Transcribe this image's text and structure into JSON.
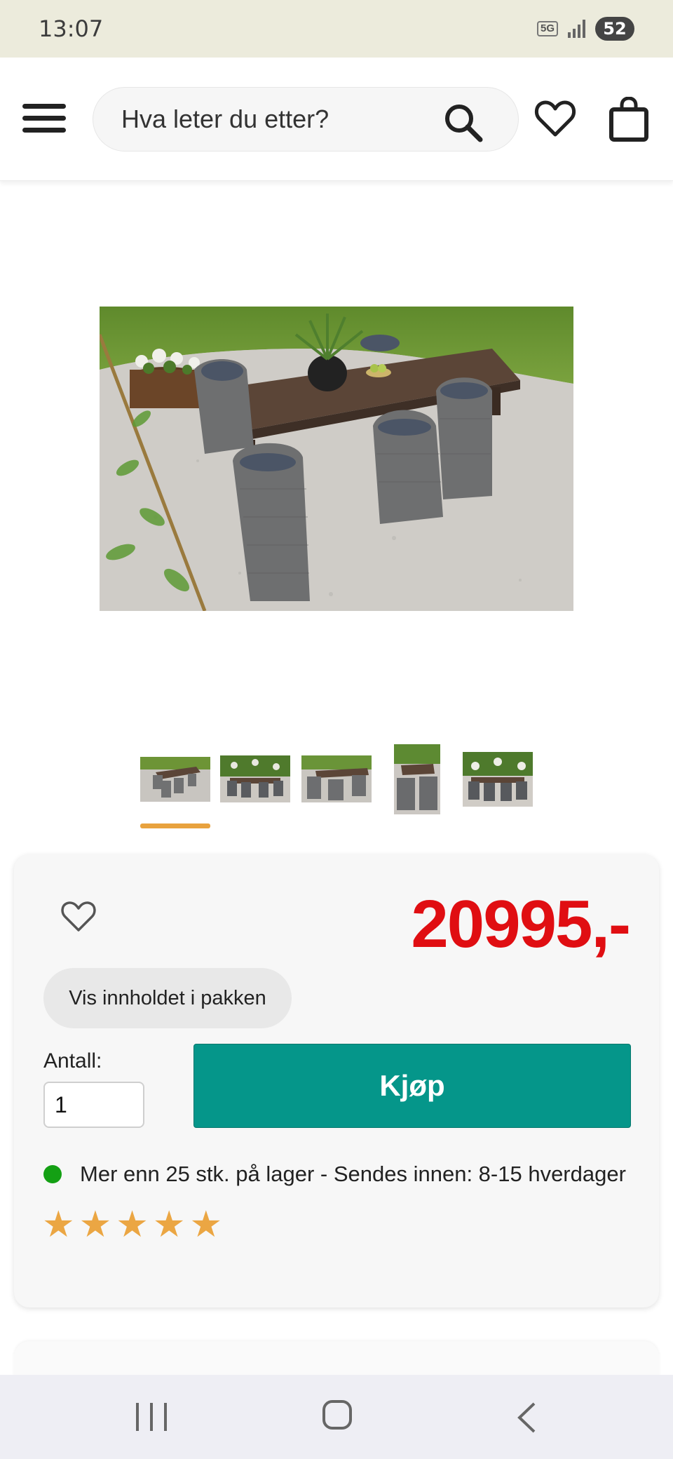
{
  "status_bar": {
    "time": "13:07",
    "network": "5G",
    "battery": "52"
  },
  "header": {
    "search_placeholder": "Hva leter du etter?",
    "icons": [
      "menu-icon",
      "search-icon",
      "heart-icon",
      "shopping-bag-icon"
    ]
  },
  "gallery": {
    "thumbnail_count": 5,
    "selected_index": 0,
    "accent_color": "#e8a23e"
  },
  "product": {
    "price": "20995,-",
    "package_button": "Vis innholdet i pakken",
    "quantity_label": "Antall:",
    "quantity_value": "1",
    "buy_button": "Kjøp",
    "stock_text": "Mer enn 25 stk. på lager - Sendes innen: 8-15 hverdager",
    "rating": 5,
    "rating_max": 5,
    "colors": {
      "price": "#e00e12",
      "buy": "#05968a",
      "stock_dot": "#14a014",
      "stars": "#eba643"
    }
  },
  "nav_bar": {
    "icons": [
      "recent-apps-icon",
      "home-icon",
      "back-icon"
    ]
  }
}
